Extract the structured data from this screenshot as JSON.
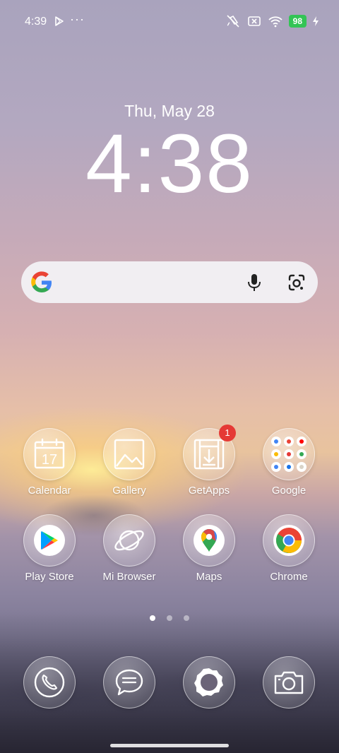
{
  "status_bar": {
    "time": "4:39",
    "more": "···",
    "battery": "98",
    "icons": [
      "play-store-notification-icon",
      "vibrate-off-icon",
      "no-sim-icon",
      "wifi-icon",
      "battery-icon",
      "charging-icon"
    ]
  },
  "clock_widget": {
    "date": "Thu, May 28",
    "time": "4:38"
  },
  "search_bar": {
    "icons": [
      "google-logo-icon",
      "microphone-icon",
      "google-lens-icon"
    ]
  },
  "apps": [
    {
      "label": "Calendar",
      "icon": "calendar-icon",
      "calendar_day": "17"
    },
    {
      "label": "Gallery",
      "icon": "gallery-icon"
    },
    {
      "label": "GetApps",
      "icon": "getapps-icon",
      "badge": "1"
    },
    {
      "label": "Google",
      "icon": "google-folder-icon"
    },
    {
      "label": "Play Store",
      "icon": "play-store-icon"
    },
    {
      "label": "Mi Browser",
      "icon": "mi-browser-icon"
    },
    {
      "label": "Maps",
      "icon": "maps-icon"
    },
    {
      "label": "Chrome",
      "icon": "chrome-icon"
    }
  ],
  "page_indicator": {
    "pages": 3,
    "current": 1
  },
  "dock": [
    {
      "icon": "phone-icon"
    },
    {
      "icon": "messages-icon"
    },
    {
      "icon": "settings-icon"
    },
    {
      "icon": "camera-icon"
    }
  ],
  "colors": {
    "battery": "#33c455",
    "badge": "#e53935"
  }
}
